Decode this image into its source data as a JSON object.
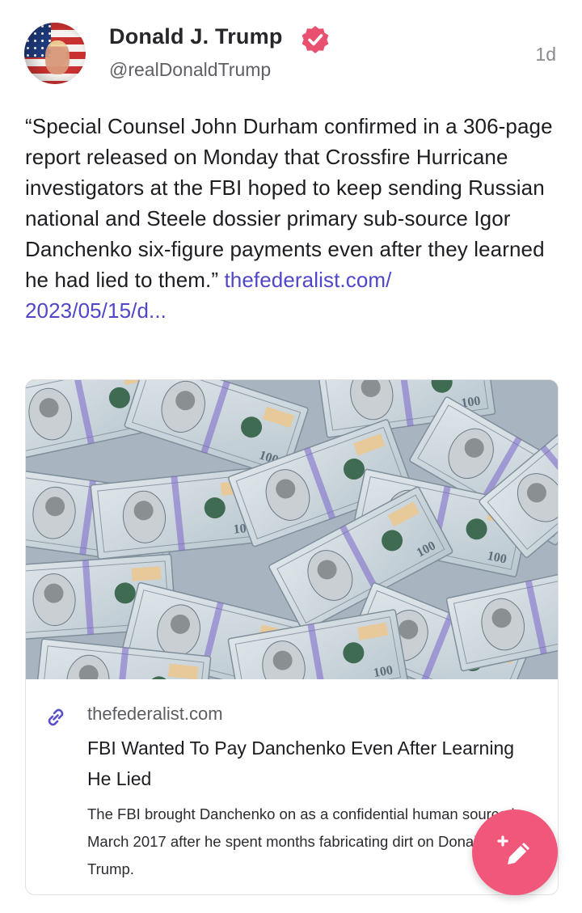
{
  "author": {
    "name": "Donald J. Trump",
    "handle": "@realDonaldTrump",
    "avatar_icon": "avatar-flag-portrait",
    "verified_icon": "verified-badge-icon",
    "badge_color": "#e9506f"
  },
  "post": {
    "timestamp": "1d",
    "text": "“Special Counsel John Durham confirmed in a 306-page report released on Monday that Crossfire Hurricane investigators at the FBI hoped to keep sending Russian national and Steele dossier primary sub-source Igor Danchenko six-figure payments even after they learned he had lied to them.”",
    "link_line1": "thefederalist.com/",
    "link_line2": "2023/05/15/d..."
  },
  "card": {
    "image_icon": "hundred-dollar-bills-image",
    "link_icon": "link-icon",
    "domain": "thefederalist.com",
    "title": "FBI Wanted To Pay Danchenko Even After Learning He Lied",
    "description": "The FBI brought Danchenko on as a confidential human source in March 2017 after he spent months fabricating dirt on Donald Trump."
  },
  "compose": {
    "icon": "compose-pencil-icon",
    "color": "#f0577a"
  },
  "colors": {
    "link": "#5047c8",
    "text": "#1d1d21",
    "muted": "#8a8a91"
  }
}
